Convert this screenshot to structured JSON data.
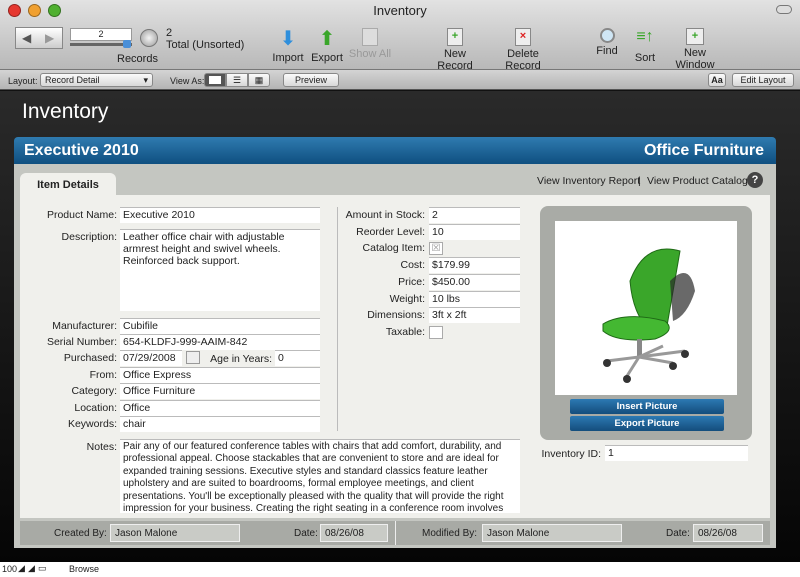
{
  "window": {
    "title": "Inventory"
  },
  "toolbar": {
    "record_number": "2",
    "records_label": "Records",
    "found_count": "2",
    "total_label": "Total (Unsorted)",
    "import": "Import",
    "export": "Export",
    "show_all": "Show All",
    "new_record": "New Record",
    "delete_record": "Delete Record",
    "find": "Find",
    "sort": "Sort",
    "new_window": "New Window"
  },
  "layoutbar": {
    "layout_label": "Layout:",
    "layout_value": "Record Detail",
    "view_as_label": "View As:",
    "preview": "Preview",
    "aa": "Aa",
    "edit_layout": "Edit Layout"
  },
  "app_title": "Inventory",
  "header": {
    "product": "Executive 2010",
    "category": "Office Furniture"
  },
  "tabs": {
    "item_details": "Item Details"
  },
  "links": {
    "report": "View Inventory Report",
    "sep": "|",
    "catalog": "View Product Catalog",
    "help": "?"
  },
  "left_fields": [
    {
      "label": "Product Name:",
      "value": "Executive 2010"
    },
    {
      "label": "Description:",
      "value": "Leather office chair with adjustable armrest height and swivel wheels. Reinforced back support."
    },
    {
      "label": "Manufacturer:",
      "value": "Cubifile"
    },
    {
      "label": "Serial Number:",
      "value": "654-KLDFJ-999-AAIM-842"
    },
    {
      "label": "Purchased:",
      "value": "07/29/2008"
    },
    {
      "label": "From:",
      "value": "Office Express"
    },
    {
      "label": "Category:",
      "value": "Office Furniture"
    },
    {
      "label": "Location:",
      "value": "Office"
    },
    {
      "label": "Keywords:",
      "value": "chair"
    }
  ],
  "age": {
    "label": "Age in Years:",
    "value": "0"
  },
  "right_fields": [
    {
      "label": "Amount in Stock:",
      "value": "2"
    },
    {
      "label": "Reorder Level:",
      "value": "10"
    },
    {
      "label": "Catalog Item:",
      "value": "☒"
    },
    {
      "label": "Cost:",
      "value": "$179.99"
    },
    {
      "label": "Price:",
      "value": "$450.00"
    },
    {
      "label": "Weight:",
      "value": "10 lbs"
    },
    {
      "label": "Dimensions:",
      "value": "3ft x 2ft"
    },
    {
      "label": "Taxable:",
      "value": ""
    }
  ],
  "picture": {
    "insert": "Insert Picture",
    "export": "Export Picture"
  },
  "inventory_id": {
    "label": "Inventory ID:",
    "value": "1"
  },
  "notes": {
    "label": "Notes:",
    "value": "Pair any of our featured conference tables with chairs that add comfort, durability, and professional appeal. Choose stackables that are convenient to store and are ideal for expanded training sessions. Executive styles and standard classics feature leather upholstery and are suited to boardrooms, formal employee meetings, and client presentations. You'll be exceptionally pleased with the quality that will provide the right impression for your business. Creating the right seating in a conference room involves both"
  },
  "footer": {
    "created_by_label": "Created By:",
    "created_by": "Jason Malone",
    "date_label": "Date:",
    "created_date": "08/26/08",
    "modified_by_label": "Modified By:",
    "modified_by": "Jason Malone",
    "modified_date": "08/26/08"
  },
  "status": {
    "zoom": "100",
    "mode": "Browse"
  },
  "colors": {
    "accent": "#1f6699",
    "chair": "#3aa62a"
  }
}
